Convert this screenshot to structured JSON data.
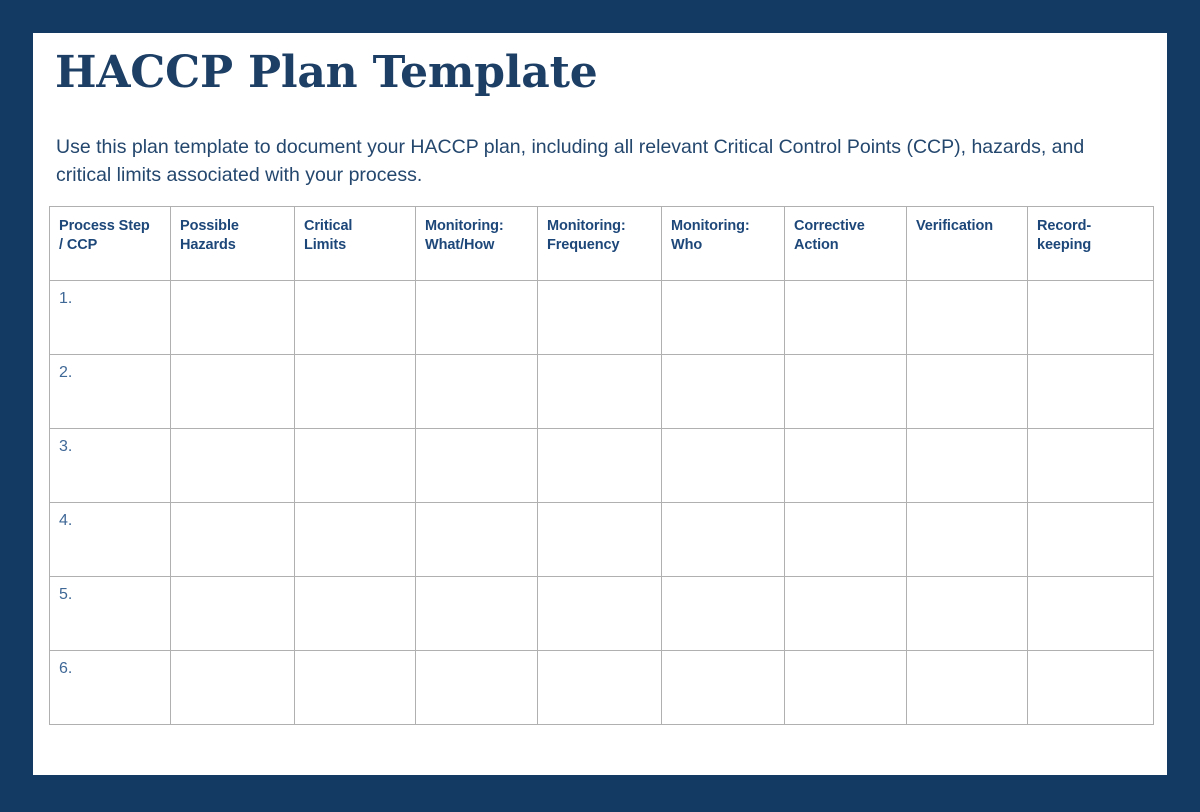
{
  "page": {
    "frame_color": "#123a63",
    "sheet_color": "#ffffff",
    "title": "HACCP Plan Template",
    "title_color": "#1d3f66",
    "subtitle": "Use this plan template to document your HACCP plan, including all relevant Critical Control Points (CCP), hazards, and critical limits associated with your process.",
    "subtitle_color": "#24476e"
  },
  "table": {
    "border_color": "#b0b0b0",
    "header_text_color": "#1d4779",
    "cell_text_color": "#3f6897",
    "headers": [
      {
        "line1": "Process Step",
        "line2": "/ CCP"
      },
      {
        "line1": "Possible",
        "line2": "Hazards"
      },
      {
        "line1": "Critical",
        "line2": "Limits"
      },
      {
        "line1": "Monitoring:",
        "line2": "What/How"
      },
      {
        "line1": "Monitoring:",
        "line2": "Frequency"
      },
      {
        "line1": "Monitoring:",
        "line2": "Who"
      },
      {
        "line1": "Corrective",
        "line2": "Action"
      },
      {
        "line1": "Verification",
        "line2": ""
      },
      {
        "line1": "Record-",
        "line2": "keeping"
      }
    ],
    "rows": [
      {
        "number": "1.",
        "cells": [
          "",
          "",
          "",
          "",
          "",
          "",
          "",
          ""
        ]
      },
      {
        "number": "2.",
        "cells": [
          "",
          "",
          "",
          "",
          "",
          "",
          "",
          ""
        ]
      },
      {
        "number": "3.",
        "cells": [
          "",
          "",
          "",
          "",
          "",
          "",
          "",
          ""
        ]
      },
      {
        "number": "4.",
        "cells": [
          "",
          "",
          "",
          "",
          "",
          "",
          "",
          ""
        ]
      },
      {
        "number": "5.",
        "cells": [
          "",
          "",
          "",
          "",
          "",
          "",
          "",
          ""
        ]
      },
      {
        "number": "6.",
        "cells": [
          "",
          "",
          "",
          "",
          "",
          "",
          "",
          ""
        ]
      }
    ]
  }
}
